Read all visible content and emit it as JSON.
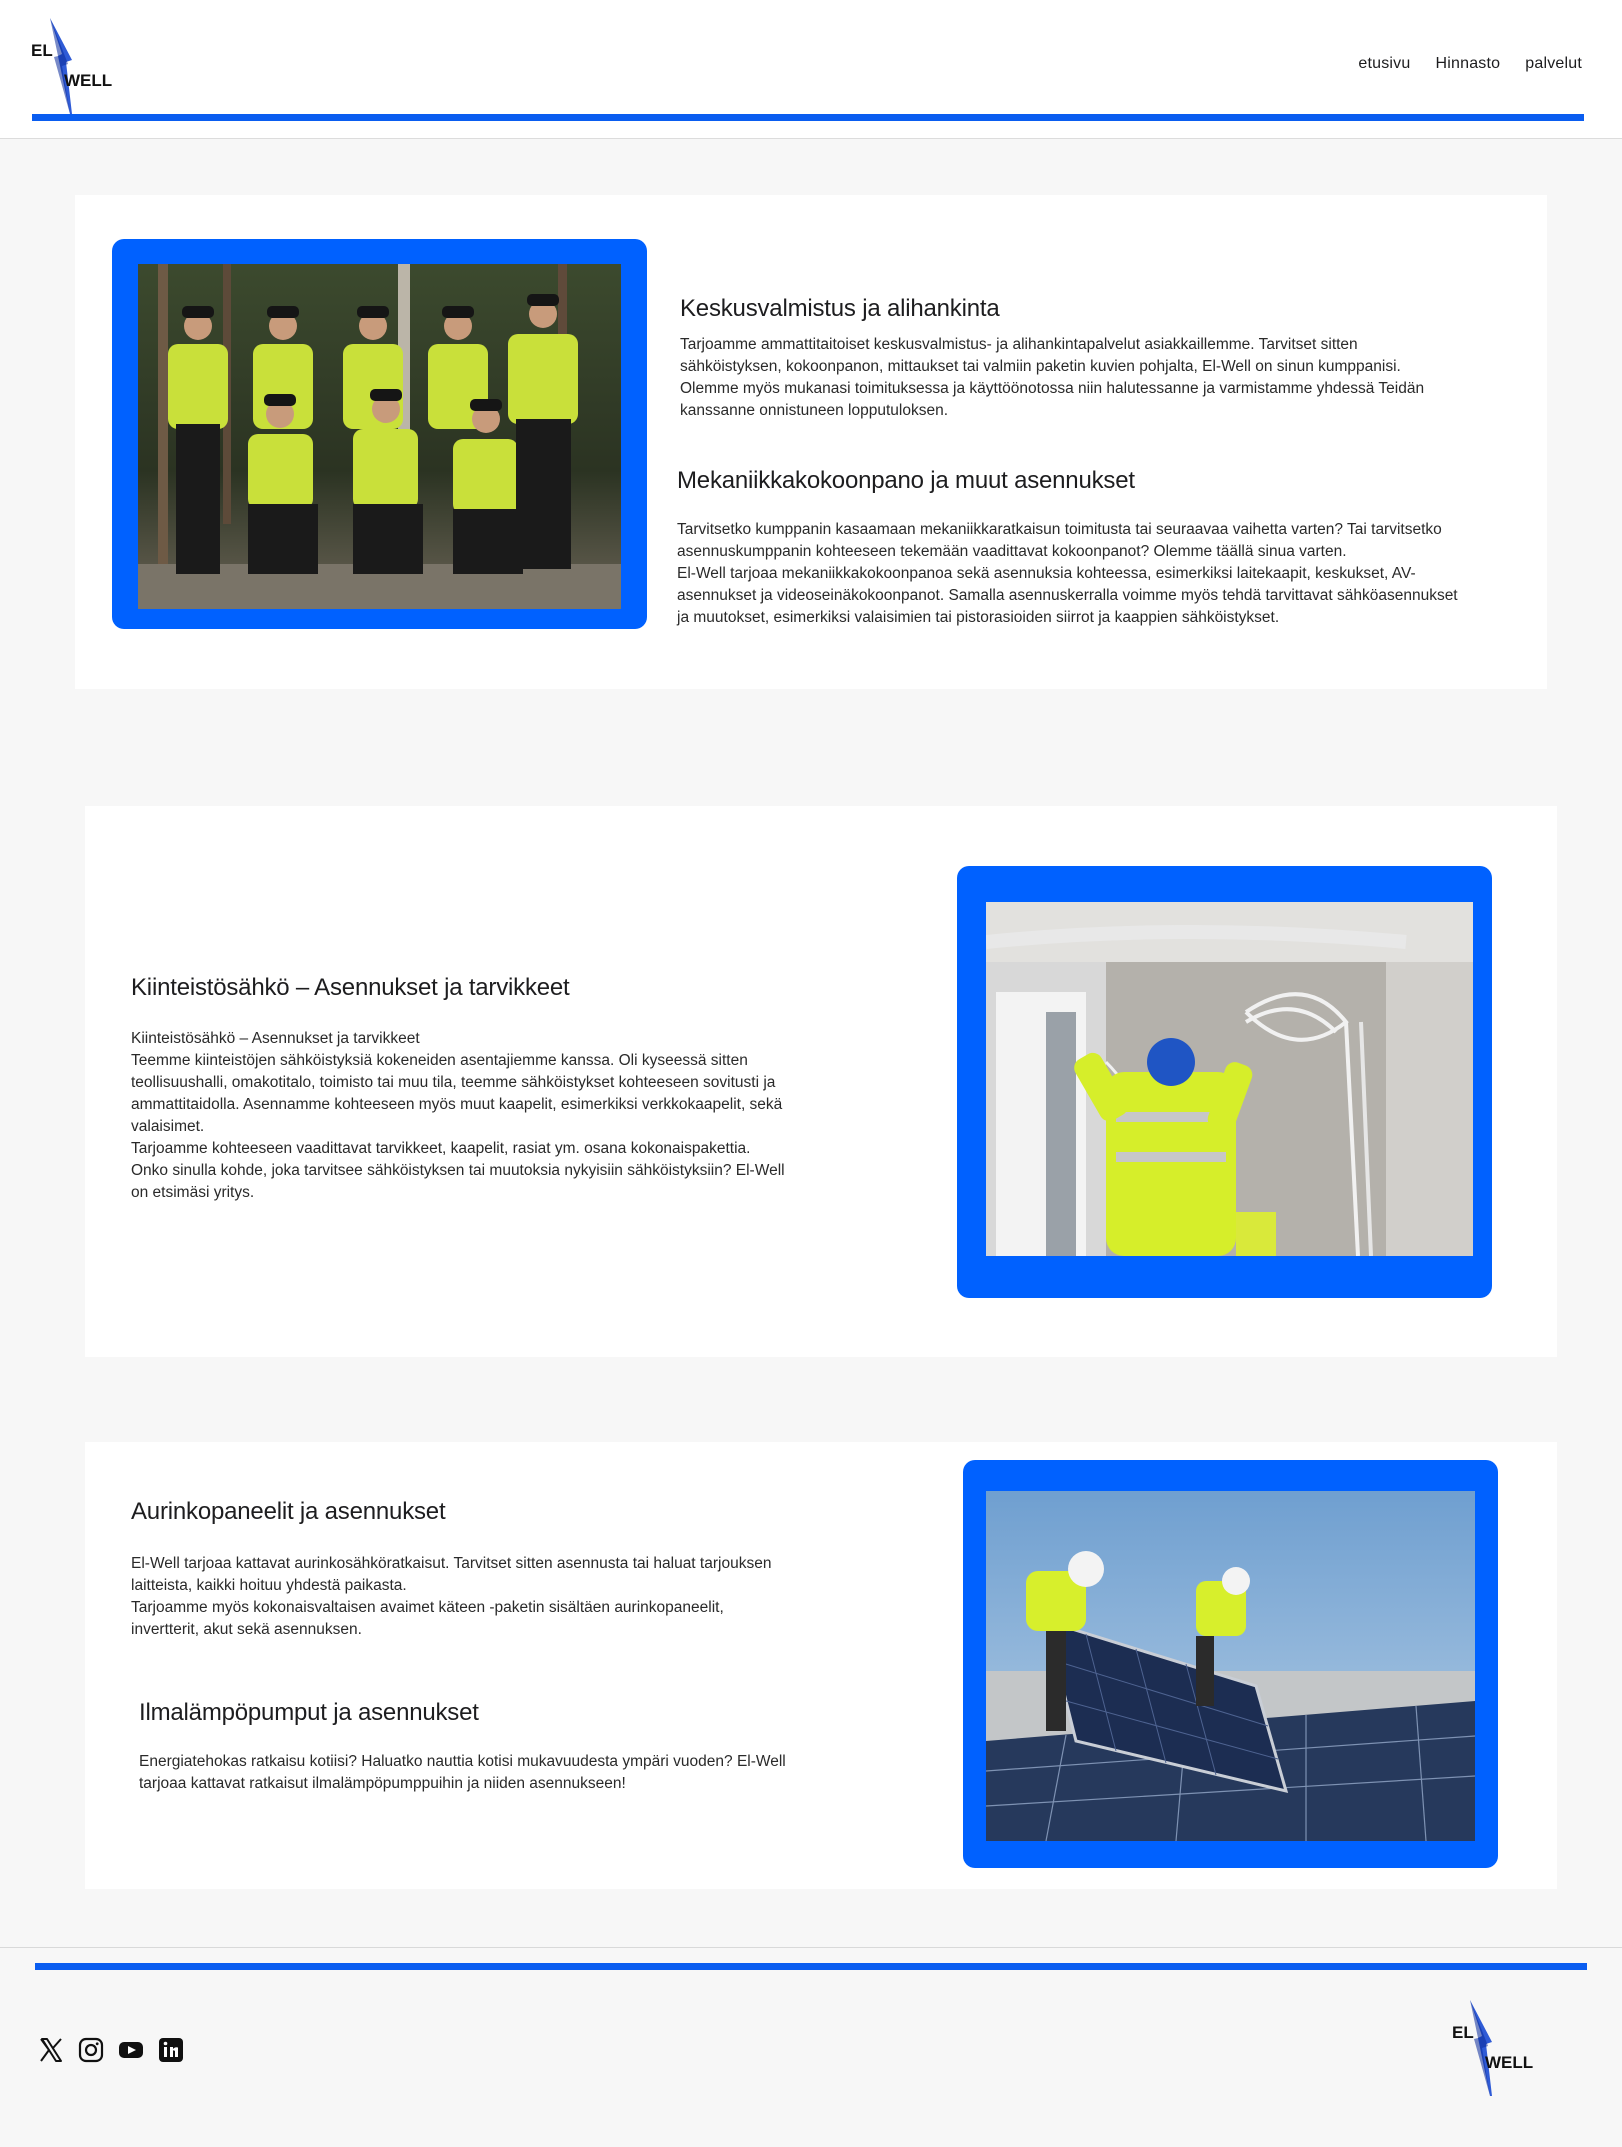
{
  "brand": {
    "logo_top": "EL",
    "logo_bottom": "WELL",
    "accent": "#0061ff"
  },
  "nav": {
    "items": [
      "etusivu",
      "Hinnasto",
      "palvelut"
    ]
  },
  "sections": {
    "keskus": {
      "title": "Keskusvalmistus ja alihankinta",
      "lines": [
        "Tarjoamme ammattitaitoiset keskusvalmistus- ja alihankintapalvelut asiakkaillemme. Tarvitset sitten",
        "sähköistyksen, kokoonpanon, mittaukset tai valmiin paketin kuvien pohjalta, El-Well on sinun kumppanisi.",
        "Olemme myös mukanasi toimituksessa ja käyttöönotossa niin halutessanne ja varmistamme yhdessä Teidän",
        "kanssanne onnistuneen lopputuloksen."
      ]
    },
    "mekaniikka": {
      "title": "Mekaniikkakokoonpano ja muut asennukset",
      "lines": [
        "Tarvitsetko kumppanin kasaamaan mekaniikkaratkaisun toimitusta tai seuraavaa vaihetta varten? Tai tarvitsetko",
        "asennuskumppanin kohteeseen tekemään vaadittavat kokoonpanot? Olemme täällä sinua varten.",
        "El-Well tarjoaa mekaniikkakokoonpanoa sekä asennuksia kohteessa, esimerkiksi laitekaapit, keskukset, AV-",
        "asennukset ja videoseinäkokoonpanot. Samalla asennuskerralla voimme myös tehdä tarvittavat sähköasennukset",
        "ja muutokset, esimerkiksi valaisimien tai pistorasioiden siirrot ja kaappien sähköistykset."
      ]
    },
    "kiinteisto": {
      "title": "Kiinteistösähkö – Asennukset ja tarvikkeet",
      "lines": [
        "Kiinteistösähkö – Asennukset ja tarvikkeet",
        "Teemme kiinteistöjen sähköistyksiä kokeneiden asentajiemme kanssa. Oli kyseessä sitten",
        "teollisuushalli, omakotitalo, toimisto tai muu tila, teemme sähköistykset kohteeseen sovitusti ja",
        "ammattitaidolla. Asennamme kohteeseen myös muut kaapelit, esimerkiksi verkkokaapelit, sekä",
        "valaisimet.",
        "Tarjoamme kohteeseen vaadittavat tarvikkeet, kaapelit, rasiat ym. osana kokonaispakettia.",
        "Onko sinulla kohde, joka tarvitsee sähköistyksen tai muutoksia nykyisiin sähköistyksiin? El-Well",
        "on etsimäsi yritys."
      ]
    },
    "aurinko": {
      "title": "Aurinkopaneelit ja asennukset",
      "lines": [
        "El-Well tarjoaa kattavat aurinkosähköratkaisut. Tarvitset sitten asennusta tai haluat tarjouksen",
        "laitteista, kaikki hoituu yhdestä paikasta.",
        "Tarjoamme myös kokonaisvaltaisen avaimet käteen -paketin sisältäen aurinkopaneelit,",
        "invertterit, akut sekä asennuksen."
      ]
    },
    "ilmalampo": {
      "title": "Ilmalämpöpumput ja asennukset",
      "lines": [
        "Energiatehokas ratkaisu kotiisi? Haluatko nauttia kotisi mukavuudesta ympäri vuoden? El-Well",
        "tarjoaa kattavat ratkaisut ilmalämpöpumppuihin ja niiden asennukseen!"
      ]
    }
  },
  "footer": {
    "social_icons": [
      "x-icon",
      "instagram-icon",
      "youtube-icon",
      "linkedin-icon"
    ]
  }
}
